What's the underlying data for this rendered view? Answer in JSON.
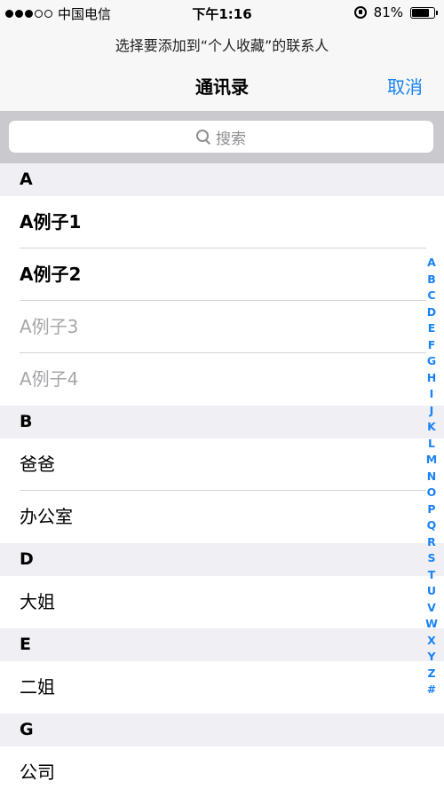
{
  "status_bar": {
    "carrier": "中国电信",
    "time": "下午1:16",
    "battery": "81%",
    "battery_level": 0.81,
    "signal_filled": 3,
    "signal_total": 5
  },
  "header": {
    "prompt": "选择要添加到“个人收藏”的联系人",
    "title": "通讯录",
    "cancel_label": "取消"
  },
  "search": {
    "placeholder": "搜索"
  },
  "sections": [
    {
      "letter": "A",
      "items": [
        {
          "name": "A例子1",
          "style": "bold"
        },
        {
          "name": "A例子2",
          "style": "bold"
        },
        {
          "name": "A例子3",
          "style": "gray"
        },
        {
          "name": "A例子4",
          "style": "gray"
        }
      ]
    },
    {
      "letter": "B",
      "items": [
        {
          "name": "爸爸",
          "style": "normal"
        },
        {
          "name": "办公室",
          "style": "normal"
        }
      ]
    },
    {
      "letter": "D",
      "items": [
        {
          "name": "大姐",
          "style": "normal"
        }
      ]
    },
    {
      "letter": "E",
      "items": [
        {
          "name": "二姐",
          "style": "normal"
        }
      ]
    },
    {
      "letter": "G",
      "items": [
        {
          "name": "公司",
          "style": "normal"
        }
      ]
    }
  ],
  "index_letters": [
    "A",
    "B",
    "C",
    "D",
    "E",
    "F",
    "G",
    "H",
    "I",
    "J",
    "K",
    "L",
    "M",
    "N",
    "O",
    "P",
    "Q",
    "R",
    "S",
    "T",
    "U",
    "V",
    "W",
    "X",
    "Y",
    "Z",
    "#"
  ],
  "colors": {
    "accent": "#1a82f5",
    "section_bg": "#efeff4",
    "disabled_text": "#a7a7ab"
  }
}
